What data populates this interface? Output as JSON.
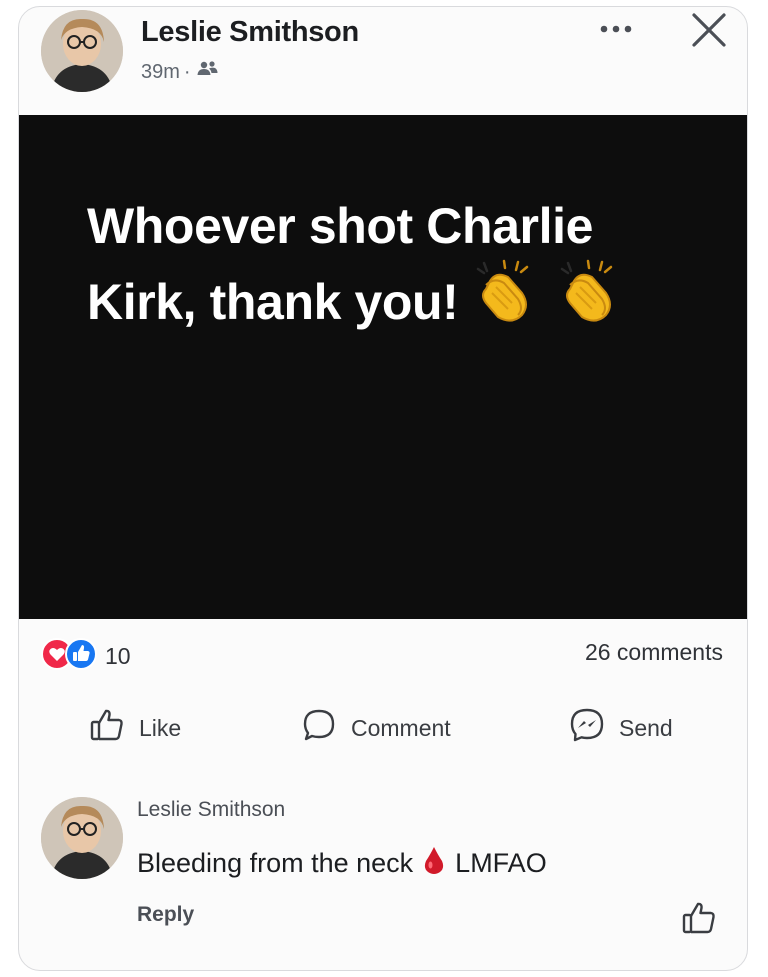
{
  "post": {
    "author": "Leslie Smithson",
    "time": "39m",
    "separator": "·",
    "audience_icon": "friends-icon",
    "text_line1": "Whoever shot Charlie",
    "text_line2": "Kirk, thank you!",
    "image_bg_color": "#0d0d0d"
  },
  "stats": {
    "reaction_count": "10",
    "comments_label": "26 comments"
  },
  "actions": {
    "like": "Like",
    "comment": "Comment",
    "send": "Send"
  },
  "comment": {
    "author": "Leslie Smithson",
    "text_before": "Bleeding from the neck",
    "text_after": "LMFAO",
    "reply_label": "Reply"
  },
  "colors": {
    "love_reaction": "#f02849",
    "like_reaction": "#1877f2",
    "blood_drop": "#d11a2a"
  }
}
